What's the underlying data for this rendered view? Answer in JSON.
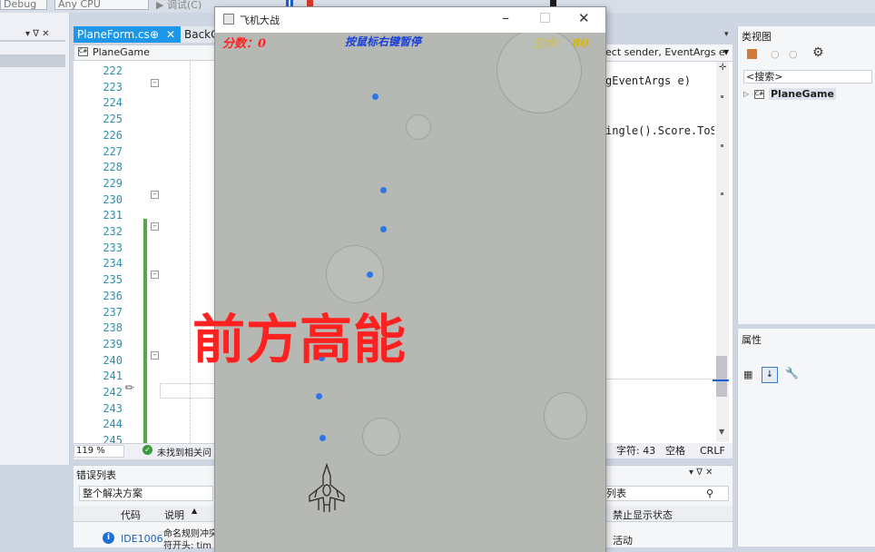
{
  "toolbar": {
    "config": "Debug",
    "platform": "Any CPU",
    "debug_label": "调试(C)"
  },
  "tabs": [
    {
      "label": "PlaneForm.cs",
      "pin": "⊕",
      "close": "✕"
    },
    {
      "label": "BackGr"
    }
  ],
  "editor": {
    "nav_class": "PlaneGame",
    "line_numbers": [
      "222",
      "223",
      "224",
      "225",
      "226",
      "227",
      "228",
      "229",
      "230",
      "231",
      "232",
      "233",
      "234",
      "235",
      "236",
      "237",
      "238",
      "239",
      "240",
      "241",
      "242",
      "243",
      "244",
      "245"
    ],
    "zoom": "119 %",
    "status": "未找到相关问"
  },
  "code_right": {
    "nav": "ect sender, EventArgs e",
    "lines": [
      "gEventArgs e)",
      "ingle().Score.ToS"
    ],
    "status_chars": "字符: 43",
    "status_space": "空格",
    "status_eol": "CRLF"
  },
  "class_view": {
    "title": "类视图",
    "search": "<搜索>",
    "tree_item": "PlaneGame"
  },
  "properties": {
    "title": "属性"
  },
  "error_list": {
    "title": "错误列表",
    "scope": "整个解决方案",
    "col_code": "代码",
    "col_desc": "说明",
    "row_code": "IDE1006",
    "row_desc_1": "命名规则冲突",
    "row_desc_2": "符开头: tim",
    "search_placeholder": "列表",
    "col_suppress": "禁止显示状态",
    "row_suppress": "活动"
  },
  "game": {
    "window_title": "飞机大战",
    "score_label": "分数：0",
    "hint": "按鼠标右键暂停",
    "life_label": "生命： 80",
    "banner": "前方高能",
    "colors": {
      "score": "#ff2020",
      "hint": "#1a3fd6",
      "life": "#d8b800",
      "bullet": "#2e76e6"
    }
  }
}
